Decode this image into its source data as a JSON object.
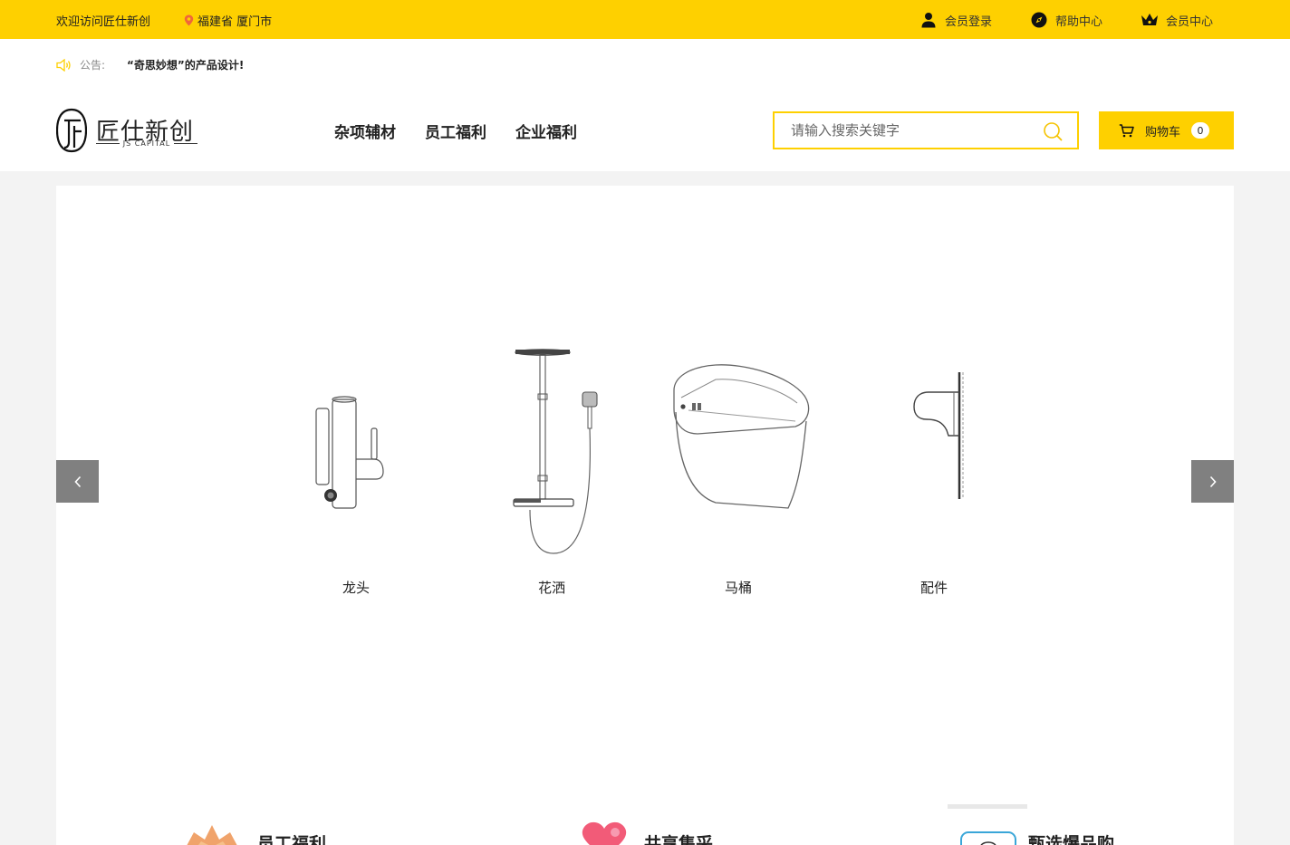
{
  "topbar": {
    "welcome": "欢迎访问匠仕新创",
    "location": "福建省 厦门市",
    "links": [
      {
        "label": "会员登录",
        "icon": "user-icon"
      },
      {
        "label": "帮助中心",
        "icon": "compass-icon"
      },
      {
        "label": "会员中心",
        "icon": "crown-icon"
      }
    ]
  },
  "notice": {
    "label": "公告:",
    "text": "“奇思妙想”的产品设计!"
  },
  "logo": {
    "cn": "匠仕新创",
    "en": "JS CAPITAL"
  },
  "nav": [
    "杂项辅材",
    "员工福利",
    "企业福利"
  ],
  "search": {
    "placeholder": "请输入搜索关键字"
  },
  "cart": {
    "label": "购物车",
    "count": "0"
  },
  "categories": [
    "龙头",
    "花洒",
    "马桶",
    "配件"
  ],
  "features": [
    "员工福利",
    "共享集采",
    "甄选爆品购"
  ],
  "colors": {
    "brand_yellow": "#fed000",
    "arrow_gray": "#808080",
    "page_bg": "#f3f3f3"
  }
}
